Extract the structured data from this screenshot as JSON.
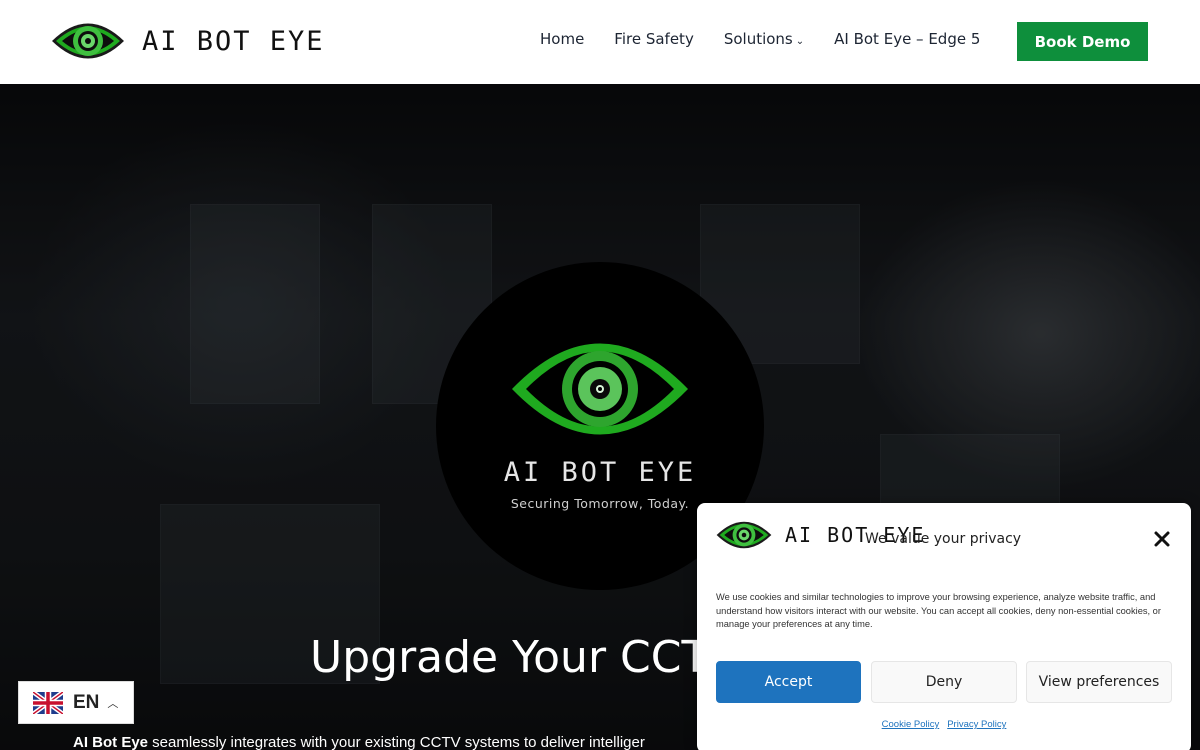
{
  "header": {
    "brand": "AI BOT EYE",
    "nav": [
      {
        "label": "Home"
      },
      {
        "label": "Fire Safety"
      },
      {
        "label": "Solutions"
      },
      {
        "label": "AI Bot Eye – Edge 5"
      }
    ],
    "cta": "Book Demo"
  },
  "hero": {
    "logo_text": "AI BOT EYE",
    "tagline": "Securing Tomorrow, Today.",
    "heading": "Upgrade Your CCT",
    "body_bold": "AI Bot Eye",
    "body_rest": " seamlessly integrates with your existing CCTV systems to deliver intelliger"
  },
  "language": {
    "code": "EN"
  },
  "cookie": {
    "brand": "AI BOT EYE",
    "title": "We value your privacy",
    "text": "We use cookies and similar technologies to improve your browsing experience, analyze website traffic, and understand how visitors interact with our website. You can accept all cookies, deny non-essential cookies, or manage your preferences at any time.",
    "accept": "Accept",
    "deny": "Deny",
    "preferences": "View preferences",
    "cookie_policy": "Cookie Policy",
    "privacy_policy": "Privacy Policy"
  },
  "colors": {
    "brand_green": "#0e8f3c",
    "eye_green": "#1faa1f",
    "accept_blue": "#1e73be"
  }
}
